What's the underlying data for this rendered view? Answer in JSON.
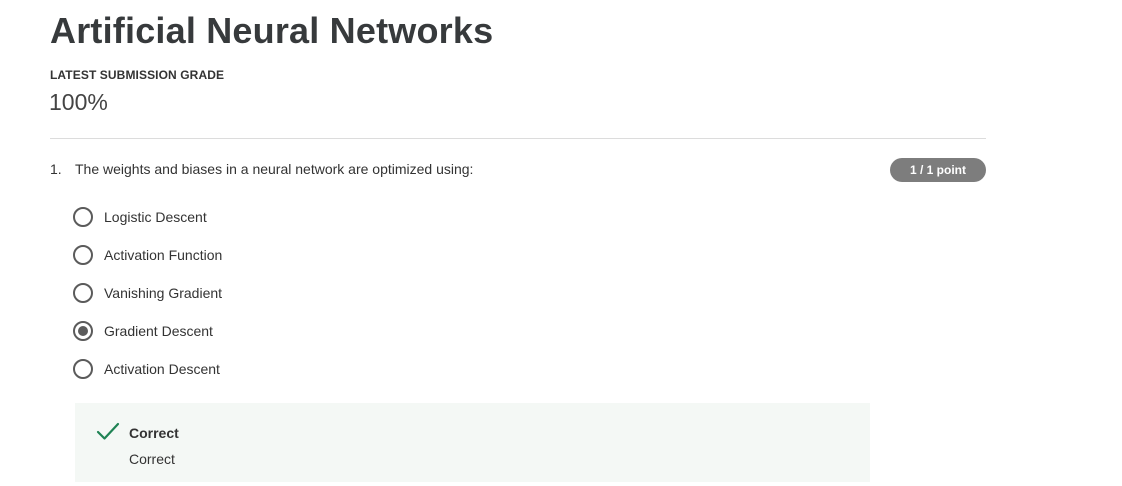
{
  "page": {
    "title": "Artificial Neural Networks"
  },
  "grade": {
    "label": "LATEST SUBMISSION GRADE",
    "value": "100%"
  },
  "question": {
    "number": "1.",
    "text": "The weights and biases in a neural network are optimized using:",
    "points": "1 / 1 point",
    "options": [
      {
        "label": "Logistic Descent",
        "selected": false
      },
      {
        "label": "Activation Function",
        "selected": false
      },
      {
        "label": "Vanishing Gradient",
        "selected": false
      },
      {
        "label": "Gradient Descent",
        "selected": true
      },
      {
        "label": "Activation Descent",
        "selected": false
      }
    ],
    "feedback": {
      "icon": "check-icon",
      "status": "Correct",
      "text": "Correct",
      "color": "#1f8354"
    }
  }
}
